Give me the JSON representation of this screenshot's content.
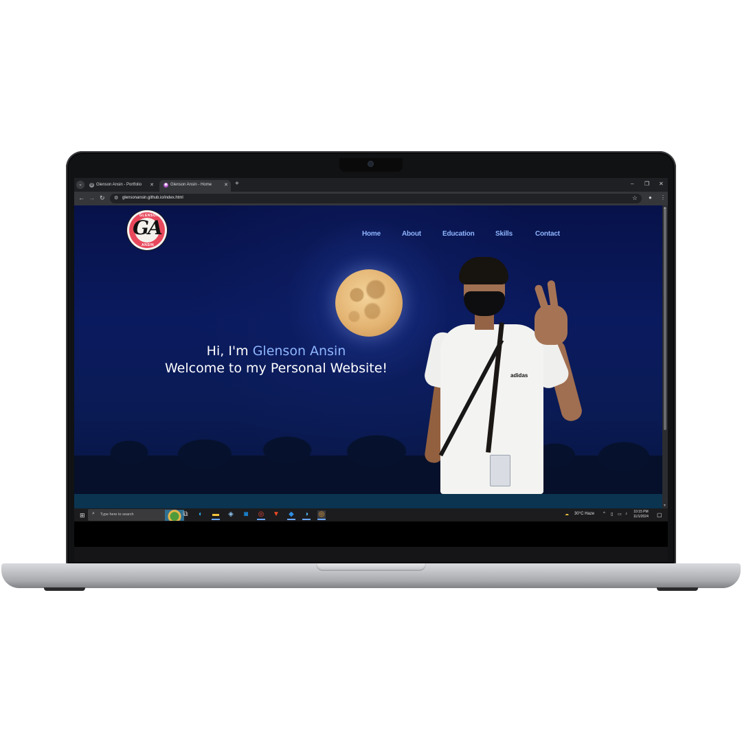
{
  "browser": {
    "tabs": [
      {
        "title": "Glenson Ansin - Portfolio",
        "active": false
      },
      {
        "title": "Glenson Ansin - Home",
        "active": true
      }
    ],
    "new_tab_symbol": "+",
    "url": "glensonansin.github.io/index.html"
  },
  "site": {
    "logo_text": "GA",
    "logo_top_text": "GLENSON",
    "logo_bottom_text": "ANSIN",
    "nav": [
      "Home",
      "About",
      "Education",
      "Skills",
      "Contact"
    ],
    "hero": {
      "greeting": "Hi, I'm ",
      "name": "Glenson Ansin",
      "welcome": "Welcome to my Personal Website!"
    },
    "shirt_brand": "adidas"
  },
  "taskbar": {
    "search_placeholder": "Type here to search",
    "weather": "30°C  Haze",
    "time": "10:15 PM",
    "date": "11/1/2024",
    "apps": [
      "task-view-icon",
      "edge-icon",
      "file-explorer-icon",
      "store-icon",
      "outlook-icon",
      "chrome-icon",
      "brave-icon",
      "vscode-icon",
      "edge-beta-icon",
      "chrome-active-icon"
    ]
  },
  "colors": {
    "accent": "#8fb6ff",
    "page_bg": "#0a1a5e",
    "logo_red": "#e8485c"
  }
}
